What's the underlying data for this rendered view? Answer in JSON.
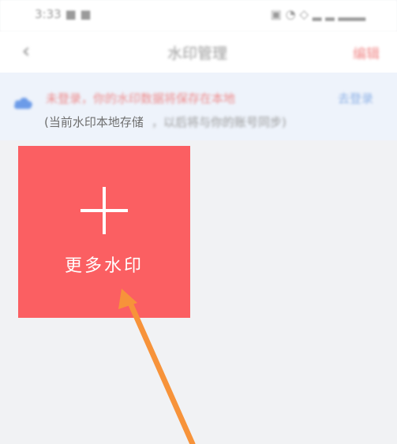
{
  "status_bar": {
    "left_text": "3:33 ■ ■",
    "right_text": "▣ ◔ ◇ ▂ ▂ ▂▂▂"
  },
  "nav": {
    "back_glyph": "‹",
    "title": "水印管理",
    "action": "编辑"
  },
  "notice": {
    "line1": "未登录，你的水印数据将保存在本地",
    "link": "去登录",
    "line2_prefix": "(当前水印本地存储",
    "line2_suffix": "，以后将与你的账号同步)"
  },
  "tile": {
    "label": "更多水印"
  },
  "colors": {
    "tile_bg": "#fb5f62",
    "arrow": "#f7933a",
    "notice_bg": "#eef3fb"
  },
  "icons": {
    "back": "back-icon",
    "cloud": "cloud-icon",
    "plus": "plus-icon",
    "arrow": "arrow-annotation-icon"
  }
}
